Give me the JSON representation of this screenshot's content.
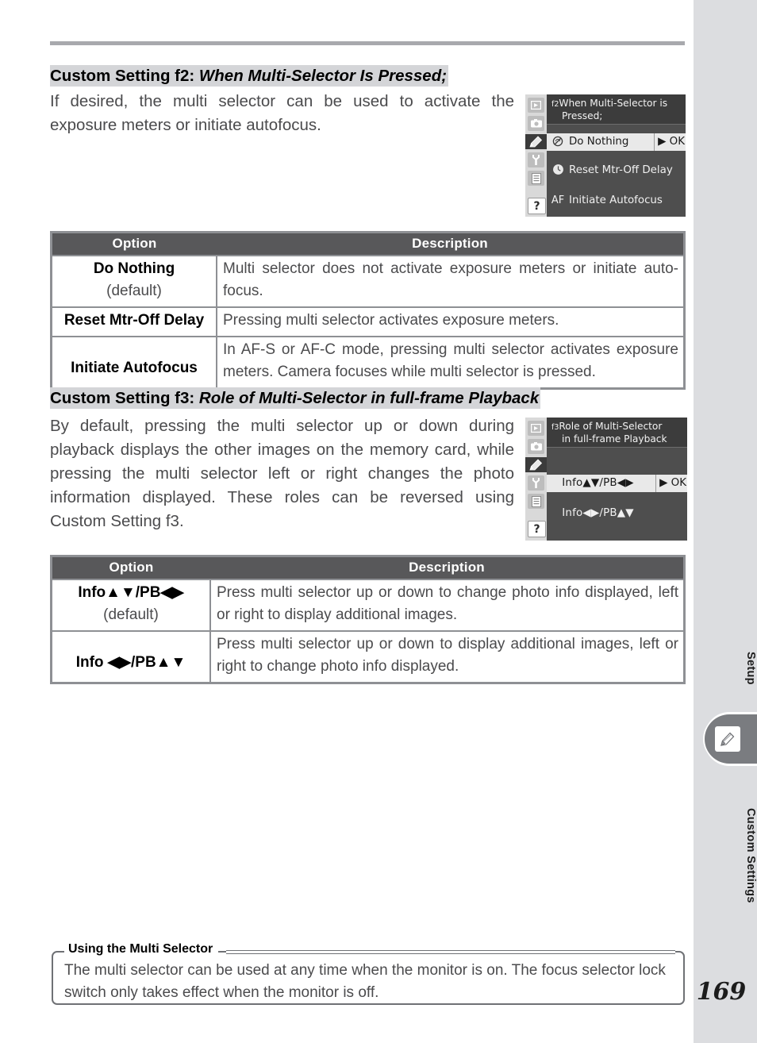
{
  "page": {
    "number": "169",
    "sidebar": {
      "label_top": "Setup",
      "label_bottom": "Custom Settings",
      "tab_icon": "pencil-icon"
    }
  },
  "sections": [
    {
      "id": "f2",
      "heading_prefix": "Custom Setting f2:",
      "heading_title": "When Multi-Selector Is Pressed;",
      "body": "If desired, the multi selector can be used to activate the exposure meters or initiate autofocus.",
      "lcd": {
        "title_line1_prefix": "f2",
        "title_line1": "When Multi-Selector is",
        "title_line2": "Pressed;",
        "rail_icons": [
          "play-icon",
          "camera-icon",
          "pencil-icon",
          "wrench-icon",
          "list-icon",
          "question-icon"
        ],
        "rows": [
          {
            "icon": "no-action-icon",
            "label": "Do Nothing",
            "selected": true,
            "ok": "▶ OK"
          },
          {
            "icon": "meter-icon",
            "label": "Reset Mtr-Off Delay",
            "selected": false,
            "ok": ""
          },
          {
            "icon": "AF",
            "label": "Initiate Autofocus",
            "selected": false,
            "ok": ""
          }
        ]
      },
      "table": {
        "headers": [
          "Option",
          "Description"
        ],
        "rows": [
          {
            "option": "Do Nothing",
            "option_note": "(default)",
            "description": "Multi selector does not activate exposure meters or initiate auto-focus."
          },
          {
            "option": "Reset Mtr-Off Delay",
            "option_note": "",
            "description": "Pressing multi selector activates exposure meters."
          },
          {
            "option": "Initiate Autofocus",
            "option_note": "",
            "description": "In AF-S or AF-C mode, pressing multi selector activates exposure meters.  Camera focuses while multi selector is pressed."
          }
        ]
      }
    },
    {
      "id": "f3",
      "heading_prefix": "Custom Setting f3:",
      "heading_title": "Role of Multi-Selector in full-frame Playback",
      "body": "By default, pressing the multi selector up or down during playback displays the other images on the memory card, while pressing the multi selector left or right changes the photo information displayed.  These roles can be reversed using Custom Setting f3.",
      "lcd": {
        "title_line1_prefix": "f3",
        "title_line1": "Role of Multi-Selector",
        "title_line2": "in full-frame Playback",
        "rail_icons": [
          "play-icon",
          "camera-icon",
          "pencil-icon",
          "wrench-icon",
          "list-icon",
          "question-icon"
        ],
        "rows": [
          {
            "icon": "",
            "label": "Info▲▼/PB◀▶",
            "selected": true,
            "ok": "▶ OK"
          },
          {
            "icon": "",
            "label": "Info◀▶/PB▲▼",
            "selected": false,
            "ok": ""
          }
        ]
      },
      "table": {
        "headers": [
          "Option",
          "Description"
        ],
        "rows": [
          {
            "option": "Info▲▼/PB◀▶",
            "option_note": "(default)",
            "description": "Press multi selector up or down to change photo info displayed, left or right to display additional images."
          },
          {
            "option": "Info ◀▶/PB▲▼",
            "option_note": "",
            "description": "Press multi selector up or down to display additional images, left or right to change photo info displayed."
          }
        ]
      }
    }
  ],
  "note": {
    "title": "Using the Multi Selector",
    "body": "The multi selector can be used at any time when the monitor is on.  The focus selector lock switch only takes effect when the monitor is off."
  }
}
